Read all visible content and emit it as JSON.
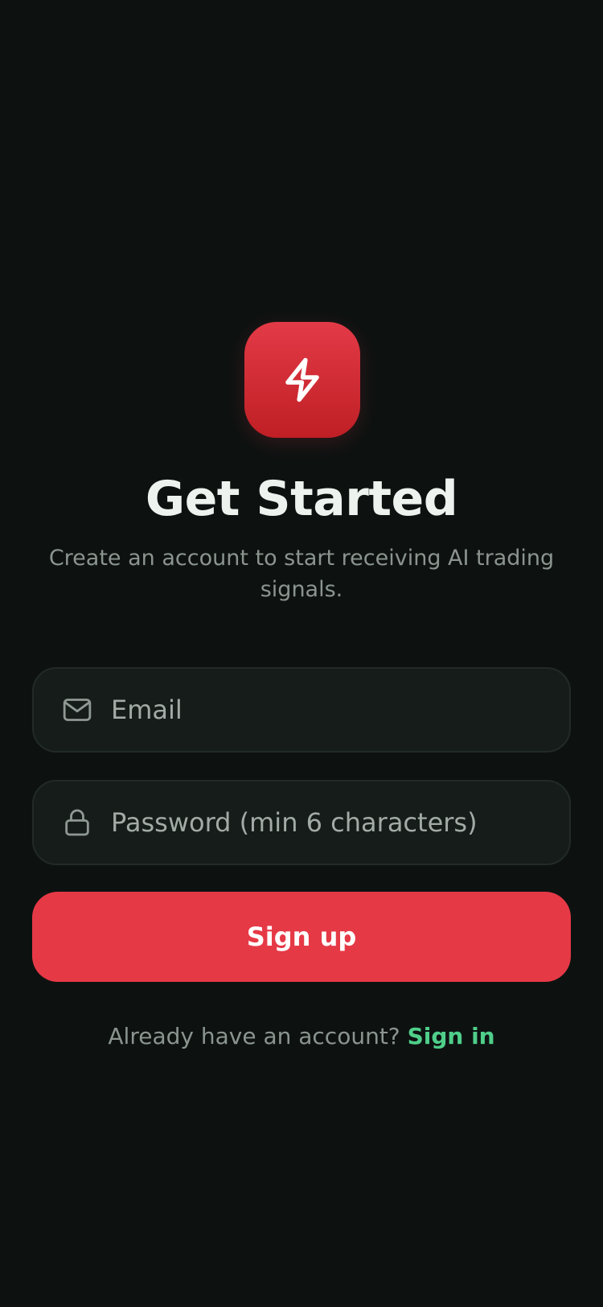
{
  "app": {
    "brand_color": "#e63946",
    "link_color": "#4fcf8a",
    "background_color": "#0d1211"
  },
  "logo": {
    "icon": "lightning-bolt-icon"
  },
  "header": {
    "title": "Get Started",
    "subtitle": "Create an account to start receiving AI trading signals."
  },
  "form": {
    "email": {
      "icon": "mail-icon",
      "placeholder": "Email",
      "value": ""
    },
    "password": {
      "icon": "lock-icon",
      "placeholder": "Password (min 6 characters)",
      "value": ""
    },
    "submit_label": "Sign up"
  },
  "footer": {
    "prompt": "Already have an account?",
    "link_label": "Sign in"
  }
}
